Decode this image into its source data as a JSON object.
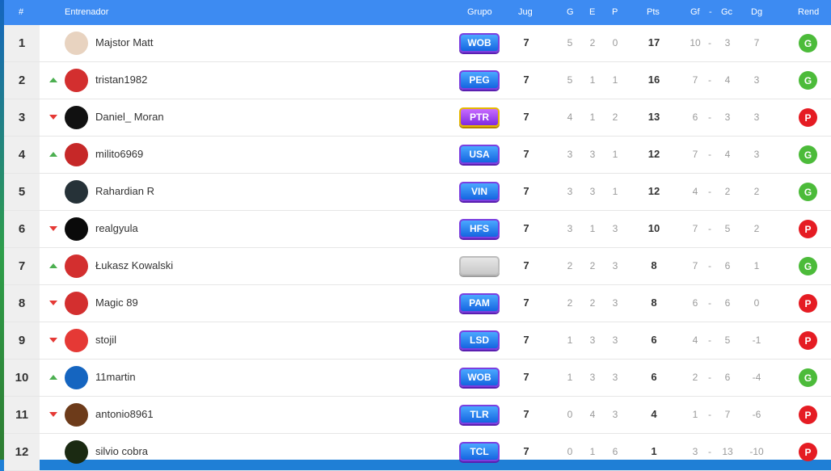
{
  "header": {
    "rank": "#",
    "coach": "Entrenador",
    "group": "Grupo",
    "played": "Jug",
    "won": "G",
    "drawn": "E",
    "lost": "P",
    "points": "Pts",
    "gf": "Gf",
    "dash": "-",
    "gc": "Gc",
    "dg": "Dg",
    "form": "Rend"
  },
  "rows": [
    {
      "rank": "1",
      "trend": "none",
      "name": "Majstor Matt",
      "group": "WOB",
      "group_style": "normal",
      "jug": "7",
      "g": "5",
      "e": "2",
      "p": "0",
      "pts": "17",
      "gf": "10",
      "gc": "3",
      "dg": "7",
      "rend": "G",
      "avatar_color": "#e8d3c0"
    },
    {
      "rank": "2",
      "trend": "up",
      "name": "tristan1982",
      "group": "PEG",
      "group_style": "normal",
      "jug": "7",
      "g": "5",
      "e": "1",
      "p": "1",
      "pts": "16",
      "gf": "7",
      "gc": "4",
      "dg": "3",
      "rend": "G",
      "avatar_color": "#d32f2f"
    },
    {
      "rank": "3",
      "trend": "down",
      "name": "Daniel_ Moran",
      "group": "PTR",
      "group_style": "gold",
      "jug": "7",
      "g": "4",
      "e": "1",
      "p": "2",
      "pts": "13",
      "gf": "6",
      "gc": "3",
      "dg": "3",
      "rend": "P",
      "avatar_color": "#111111"
    },
    {
      "rank": "4",
      "trend": "up",
      "name": "milito6969",
      "group": "USA",
      "group_style": "normal",
      "jug": "7",
      "g": "3",
      "e": "3",
      "p": "1",
      "pts": "12",
      "gf": "7",
      "gc": "4",
      "dg": "3",
      "rend": "G",
      "avatar_color": "#c62828"
    },
    {
      "rank": "5",
      "trend": "none",
      "name": "Rahardian R",
      "group": "VIN",
      "group_style": "normal",
      "jug": "7",
      "g": "3",
      "e": "3",
      "p": "1",
      "pts": "12",
      "gf": "4",
      "gc": "2",
      "dg": "2",
      "rend": "G",
      "avatar_color": "#263238"
    },
    {
      "rank": "6",
      "trend": "down",
      "name": "realgyula",
      "group": "HFS",
      "group_style": "normal",
      "jug": "7",
      "g": "3",
      "e": "1",
      "p": "3",
      "pts": "10",
      "gf": "7",
      "gc": "5",
      "dg": "2",
      "rend": "P",
      "avatar_color": "#0a0a0a"
    },
    {
      "rank": "7",
      "trend": "up",
      "name": "Łukasz Kowalski",
      "group": "",
      "group_style": "empty",
      "jug": "7",
      "g": "2",
      "e": "2",
      "p": "3",
      "pts": "8",
      "gf": "7",
      "gc": "6",
      "dg": "1",
      "rend": "G",
      "avatar_color": "#d32f2f"
    },
    {
      "rank": "8",
      "trend": "down",
      "name": "Magic 89",
      "group": "PAM",
      "group_style": "normal",
      "jug": "7",
      "g": "2",
      "e": "2",
      "p": "3",
      "pts": "8",
      "gf": "6",
      "gc": "6",
      "dg": "0",
      "rend": "P",
      "avatar_color": "#d32f2f"
    },
    {
      "rank": "9",
      "trend": "down",
      "name": "stojil",
      "group": "LSD",
      "group_style": "normal",
      "jug": "7",
      "g": "1",
      "e": "3",
      "p": "3",
      "pts": "6",
      "gf": "4",
      "gc": "5",
      "dg": "-1",
      "rend": "P",
      "avatar_color": "#e53935"
    },
    {
      "rank": "10",
      "trend": "up",
      "name": "11martin",
      "group": "WOB",
      "group_style": "normal",
      "jug": "7",
      "g": "1",
      "e": "3",
      "p": "3",
      "pts": "6",
      "gf": "2",
      "gc": "6",
      "dg": "-4",
      "rend": "G",
      "avatar_color": "#1565c0"
    },
    {
      "rank": "11",
      "trend": "down",
      "name": "antonio8961",
      "group": "TLR",
      "group_style": "normal",
      "jug": "7",
      "g": "0",
      "e": "4",
      "p": "3",
      "pts": "4",
      "gf": "1",
      "gc": "7",
      "dg": "-6",
      "rend": "P",
      "avatar_color": "#6d3b1a"
    },
    {
      "rank": "12",
      "trend": "none",
      "name": "silvio cobra",
      "group": "TCL",
      "group_style": "normal",
      "jug": "7",
      "g": "0",
      "e": "1",
      "p": "6",
      "pts": "1",
      "gf": "3",
      "gc": "13",
      "dg": "-10",
      "rend": "P",
      "avatar_color": "#1b2a12"
    }
  ]
}
